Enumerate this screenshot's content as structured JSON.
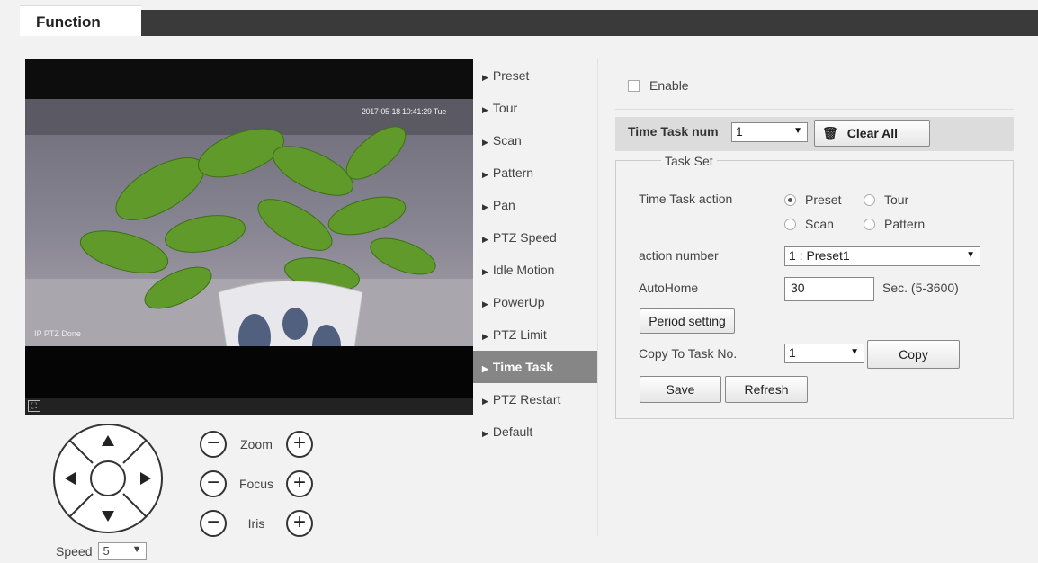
{
  "header": {
    "tab_label": "Function"
  },
  "video": {
    "timestamp": "2017-05-18 10:41:29 Tue",
    "ptz_status": "IP PTZ Done"
  },
  "ptz": {
    "zoom_label": "Zoom",
    "focus_label": "Focus",
    "iris_label": "Iris",
    "minus": "−",
    "plus": "+",
    "speed_label": "Speed",
    "speed_value": "5"
  },
  "menu": {
    "items": [
      {
        "label": "Preset"
      },
      {
        "label": "Tour"
      },
      {
        "label": "Scan"
      },
      {
        "label": "Pattern"
      },
      {
        "label": "Pan"
      },
      {
        "label": "PTZ Speed"
      },
      {
        "label": "Idle Motion"
      },
      {
        "label": "PowerUp"
      },
      {
        "label": "PTZ Limit"
      },
      {
        "label": "Time Task"
      },
      {
        "label": "PTZ Restart"
      },
      {
        "label": "Default"
      }
    ],
    "active": "Time Task"
  },
  "panel": {
    "enable_label": "Enable",
    "time_task_num_label": "Time Task num",
    "time_task_num_value": "1",
    "clear_all_label": "Clear All",
    "task_set_legend": "Task Set",
    "time_task_action_label": "Time Task action",
    "actions": [
      "Preset",
      "Tour",
      "Scan",
      "Pattern"
    ],
    "selected_action": "Preset",
    "action_number_label": "action number",
    "action_number_value": "1 : Preset1",
    "autohome_label": "AutoHome",
    "autohome_value": "30",
    "autohome_unit": "Sec. (5-3600)",
    "period_setting_label": "Period setting",
    "copy_to_label": "Copy To Task No.",
    "copy_to_value": "1",
    "copy_label": "Copy",
    "save_label": "Save",
    "refresh_label": "Refresh"
  },
  "icons": {
    "dropdown_arrow": "▼",
    "menu_arrow": "▶",
    "trash": "🗑",
    "fullscreen": "⛶"
  }
}
